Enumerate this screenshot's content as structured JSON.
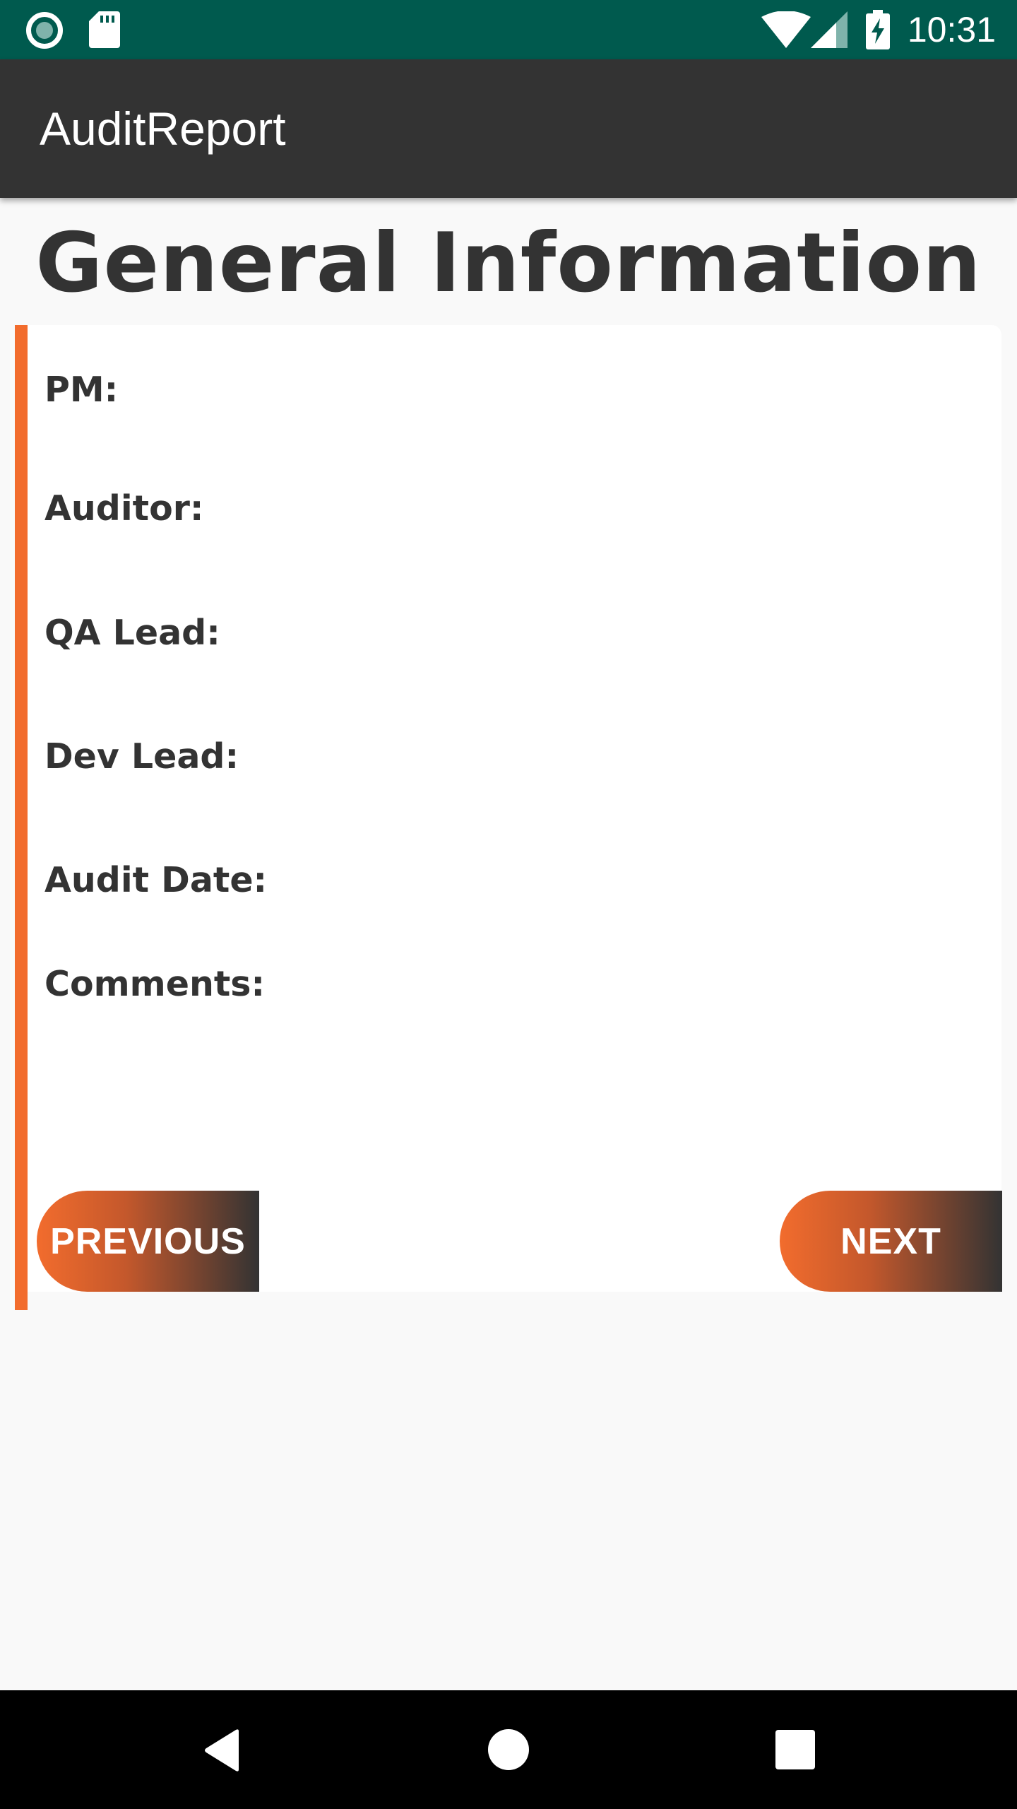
{
  "status_bar": {
    "time": "10:31",
    "icons": [
      "record-icon",
      "sd-card-icon",
      "wifi-icon",
      "signal-icon",
      "battery-charging-icon"
    ]
  },
  "app_bar": {
    "title": "AuditReport"
  },
  "page": {
    "heading": "General Information"
  },
  "form": {
    "fields": [
      {
        "label": "PM:"
      },
      {
        "label": "Auditor:"
      },
      {
        "label": "QA Lead:"
      },
      {
        "label": "Dev Lead:"
      },
      {
        "label": "Audit Date:"
      },
      {
        "label": "Comments:"
      }
    ]
  },
  "buttons": {
    "previous": "PREVIOUS",
    "next": "NEXT"
  },
  "nav_bar": {
    "icons": [
      "back-icon",
      "home-icon",
      "recents-icon"
    ]
  },
  "colors": {
    "status_bar": "#005a4e",
    "app_bar": "#333333",
    "accent": "#f26c2d",
    "text": "#333333"
  }
}
